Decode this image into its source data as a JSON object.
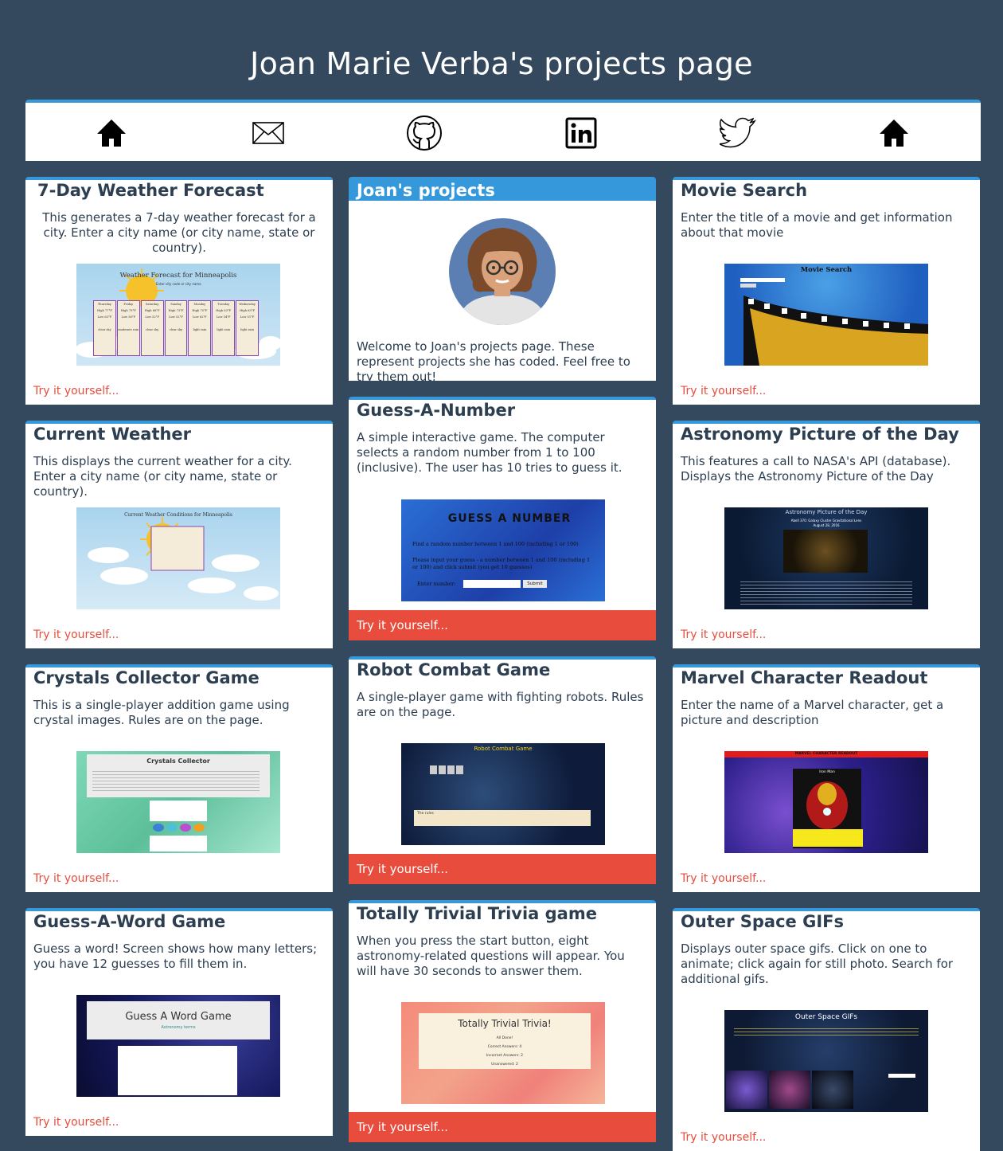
{
  "page": {
    "title": "Joan Marie Verba's projects page"
  },
  "nav": {
    "items": [
      {
        "icon": "home-icon"
      },
      {
        "icon": "mail-icon"
      },
      {
        "icon": "github-icon"
      },
      {
        "icon": "linkedin-icon"
      },
      {
        "icon": "twitter-icon"
      },
      {
        "icon": "home-icon"
      }
    ]
  },
  "colors": {
    "background": "#34495e",
    "accent": "#3498db",
    "link": "#e74c3c",
    "card": "#ffffff"
  },
  "try_label": "Try it yourself...",
  "cards": {
    "weather": {
      "title": "7-Day Weather Forecast",
      "desc": "This generates a 7-day weather forecast for a city. Enter a city name (or city name, state or country).",
      "thumb_title": "Weather Forecast for Minneapolis",
      "thumb_input": "Enter city code or city name",
      "days": [
        {
          "day": "Thursday",
          "high": "High 77°F",
          "low": "Low 63°F",
          "cond": "clear sky"
        },
        {
          "day": "Friday",
          "high": "High 79°F",
          "low": "Low 56°F",
          "cond": "moderate rain"
        },
        {
          "day": "Saturday",
          "high": "High 68°F",
          "low": "Low 52°F",
          "cond": "clear sky"
        },
        {
          "day": "Sunday",
          "high": "High 73°F",
          "low": "Low 52°F",
          "cond": "clear sky"
        },
        {
          "day": "Monday",
          "high": "High 75°F",
          "low": "Low 62°F",
          "cond": "light rain"
        },
        {
          "day": "Tuesday",
          "high": "High 63°F",
          "low": "Low 54°F",
          "cond": "light rain"
        },
        {
          "day": "Wednesday",
          "high": "High 65°F",
          "low": "Low 51°F",
          "cond": "light rain"
        }
      ]
    },
    "projects": {
      "title": "Joan's projects",
      "desc": "Welcome to Joan's projects page. These represent projects she has coded. Feel free to try them out!"
    },
    "movie": {
      "title": "Movie Search",
      "desc": "Enter the title of a movie and get information about that movie",
      "thumb_title": "Movie Search"
    },
    "current": {
      "title": "Current Weather",
      "desc": "This displays the current weather for a city. Enter a city name (or city name, state or country).",
      "thumb_title": "Current Weather Conditions for Minneapolis"
    },
    "guess_number": {
      "title": "Guess-A-Number",
      "desc": "A simple interactive game. The computer selects a random number from 1 to 100 (inclusive). The user has 10 tries to guess it.",
      "thumb_title": "GUESS A NUMBER",
      "thumb_line1": "Find a random number between 1 and 100 (including 1 or 100)",
      "thumb_line2": "Please input your guess - a number between 1 and 100 (including 1 or 100) and click submit (you get 10 guesses)",
      "thumb_label": "Enter number:",
      "thumb_button": "Submit"
    },
    "astronomy": {
      "title": "Astronomy Picture of the Day",
      "desc": "This features a call to NASA's API (database). Displays the Astronomy Picture of the Day",
      "thumb_title": "Astronomy Picture of the Day",
      "thumb_subtitle": "Abell 370: Galaxy Cluster Gravitational Lens",
      "thumb_date": "August 28, 2016"
    },
    "crystals": {
      "title": "Crystals Collector Game",
      "desc": "This is a single-player addition game using crystal images. Rules are on the page.",
      "thumb_title": "Crystals Collector"
    },
    "robot": {
      "title": "Robot Combat Game",
      "desc": "A single-player game with fighting robots. Rules are on the page.",
      "thumb_title": "Robot Combat Game",
      "thumb_rules": "The rules"
    },
    "marvel": {
      "title": "Marvel Character Readout",
      "desc": "Enter the name of a Marvel character, get a picture and description",
      "thumb_title": "MARVEL CHARACTER READOUT",
      "thumb_name": "Iron Man"
    },
    "guess_word": {
      "title": "Guess-A-Word Game",
      "desc": "Guess a word! Screen shows how many letters; you have 12 guesses to fill them in.",
      "thumb_title": "Guess A Word Game",
      "thumb_subtitle": "Astronomy terms"
    },
    "trivia": {
      "title": "Totally Trivial Trivia game",
      "desc": "When you press the start button, eight astronomy-related questions will appear. You will have 30 seconds to answer them.",
      "thumb_title": "Totally Trivial Trivia!",
      "thumb_lines": [
        "All Done!",
        "Correct Answers: 4",
        "Incorrect Answers: 2",
        "Unanswered: 2"
      ]
    },
    "gifs": {
      "title": "Outer Space GIFs",
      "desc": "Displays outer space gifs. Click on one to animate; click again for still photo. Search for additional gifs.",
      "thumb_title": "Outer Space GIFs"
    }
  }
}
